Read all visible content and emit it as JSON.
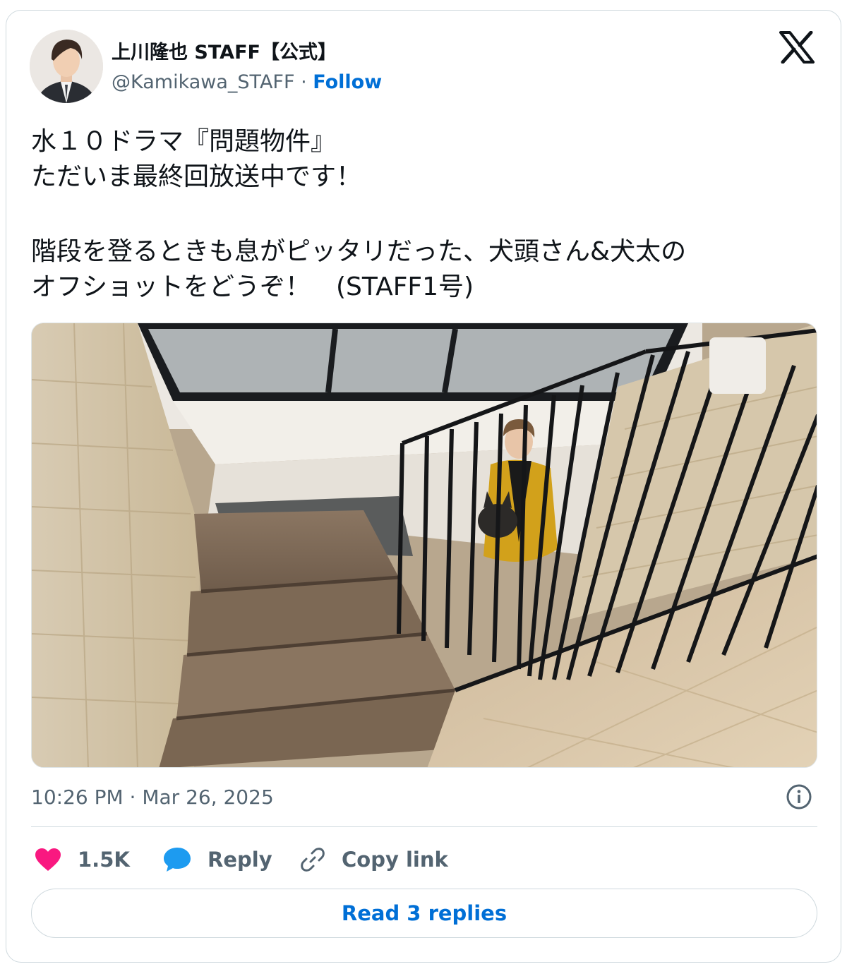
{
  "author": {
    "display_name": "上川隆也 STAFF【公式】",
    "handle": "@Kamikawa_STAFF",
    "separator": " · ",
    "follow_label": "Follow",
    "avatar_icon": "profile-photo-man-in-suit"
  },
  "brand_icon": "x-logo",
  "tweet": {
    "lines": [
      "水１０ドラマ『問題物件』",
      "ただいま最終回放送中です！",
      "階段を登るときも息がピッタリだった、犬頭さん&犬太の",
      "オフショットをどうぞ！　(STAFF1号)"
    ],
    "photo_icon": "photo-staircase-man-yellow-coat-with-dog"
  },
  "meta": {
    "timestamp": "10:26 PM · Mar 26, 2025",
    "info_icon": "info-icon"
  },
  "actions": {
    "like_count": "1.5K",
    "reply_label": "Reply",
    "copy_label": "Copy link",
    "read_replies_label": "Read 3 replies"
  },
  "colors": {
    "like": "#f91880",
    "reply": "#1d9bf0",
    "link": "#006fd6",
    "muted": "#536471",
    "border": "#cfd9de"
  }
}
